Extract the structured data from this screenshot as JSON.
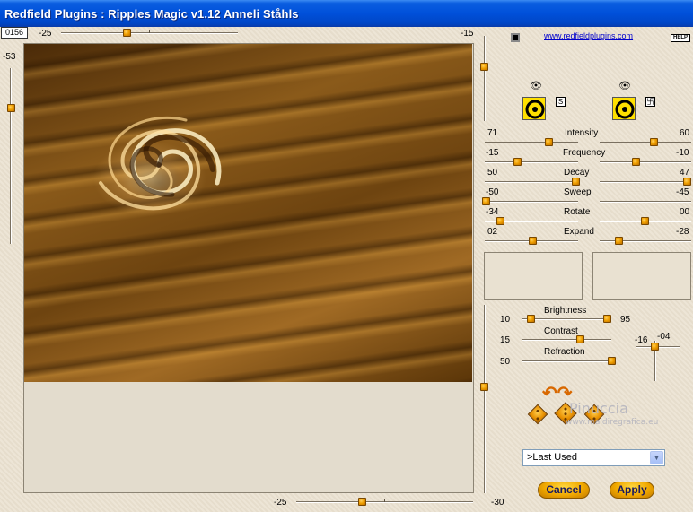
{
  "window": {
    "title": "Redfield Plugins : Ripples Magic v1.12   Anneli Ståhls"
  },
  "header": {
    "frame_counter": "0156",
    "url": "www.redfieldplugins.com",
    "help_label": "HELP"
  },
  "preview_sliders": {
    "top_left_value": "-25",
    "top_right_value": "-15",
    "left_value": "-53",
    "bottom_left_value": "-25",
    "bottom_right_value": "-30"
  },
  "params": [
    {
      "label": "Intensity",
      "left": "71",
      "right": "60"
    },
    {
      "label": "Frequency",
      "left": "-15",
      "right": "-10"
    },
    {
      "label": "Decay",
      "left": "50",
      "right": "47"
    },
    {
      "label": "Sweep",
      "left": "-50",
      "right": "-45"
    },
    {
      "label": "Rotate",
      "left": "-34",
      "right": "00"
    },
    {
      "label": "Expand",
      "left": "02",
      "right": "-28"
    }
  ],
  "lighting": {
    "brightness_label": "Brightness",
    "brightness_left": "10",
    "brightness_right": "95",
    "contrast_label": "Contrast",
    "contrast_value": "15",
    "refraction_label": "Refraction",
    "refraction_value": "50",
    "light_x": "-16",
    "light_y": "-04"
  },
  "preset": {
    "selected": ">Last Used"
  },
  "buttons": {
    "cancel": "Cancel",
    "apply": "Apply"
  },
  "watermark": {
    "name": "Pinuccia",
    "site": "www.maidiregrafica.eu"
  },
  "colors": {
    "title_bar": "#0050da",
    "accent_orange": "#f0a000",
    "button_text": "#1a1a60",
    "link": "#0000cc"
  }
}
